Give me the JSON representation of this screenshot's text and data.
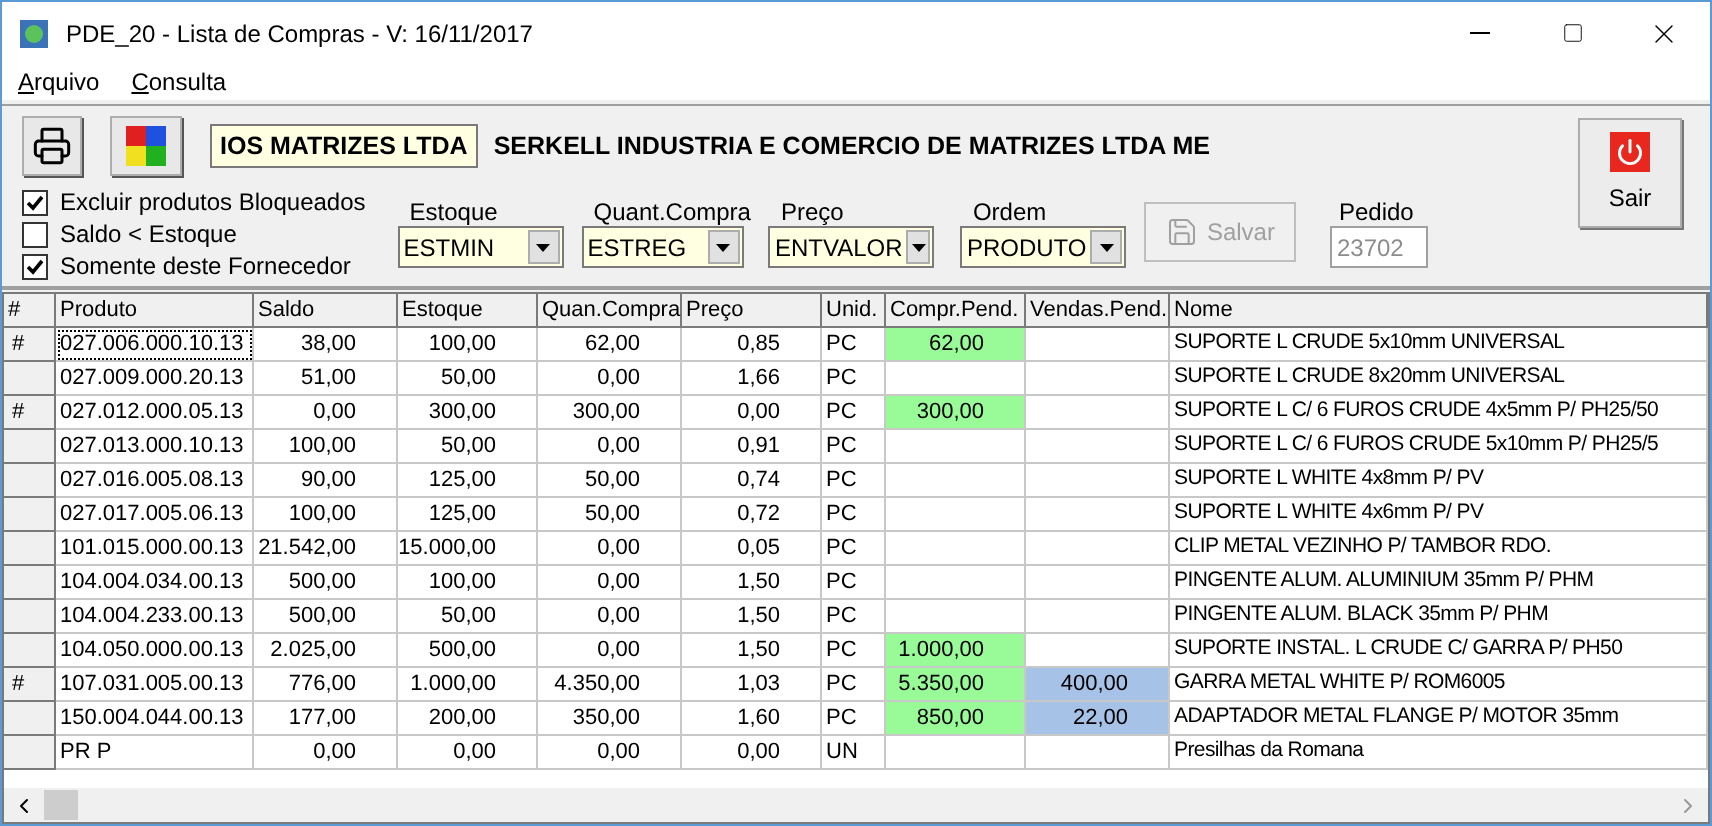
{
  "window": {
    "title": "PDE_20 - Lista de Compras - V: 16/11/2017"
  },
  "menu": [
    "Arquivo",
    "Consulta"
  ],
  "supplier": {
    "code": "IOS MATRIZES LTDA",
    "name": "SERKELL INDUSTRIA E COMERCIO DE MATRIZES LTDA ME"
  },
  "options": [
    {
      "label": "Excluir produtos Bloqueados",
      "checked": true
    },
    {
      "label": "Saldo < Estoque",
      "checked": false
    },
    {
      "label": "Somente deste Fornecedor",
      "checked": true
    }
  ],
  "dropdowns": [
    {
      "label": "Estoque",
      "value": "ESTMIN"
    },
    {
      "label": "Quant.Compra",
      "value": "ESTREG"
    },
    {
      "label": "Preço",
      "value": "ENTVALOR"
    },
    {
      "label": "Ordem",
      "value": "PRODUTO"
    }
  ],
  "save_button": {
    "label": "Salvar",
    "disabled": true
  },
  "order": {
    "label": "Pedido",
    "value": "23702",
    "disabled": true
  },
  "exit_button": {
    "label": "Sair"
  },
  "table": {
    "columns": [
      "#",
      "Produto",
      "Saldo",
      "Estoque",
      "Quan.Compra",
      "Preço",
      "Unid.",
      "Compr.Pend.",
      "Vendas.Pend.",
      "Nome"
    ],
    "rows": [
      {
        "marker": "#",
        "focused": true,
        "produto": "027.006.000.10.13",
        "saldo": "38,00",
        "estoque": "100,00",
        "quan_compra": "62,00",
        "preco": "0,85",
        "unid": "PC",
        "compr_pend": {
          "text": "62,00",
          "color": "#98fb98"
        },
        "nome": "SUPORTE L CRUDE 5x10mm UNIVERSAL"
      },
      {
        "focused": false,
        "produto": "027.009.000.20.13",
        "saldo": "51,00",
        "estoque": "50,00",
        "quan_compra": "0,00",
        "preco": "1,66",
        "unid": "PC",
        "nome": "SUPORTE L CRUDE 8x20mm UNIVERSAL"
      },
      {
        "marker": "#",
        "focused": false,
        "produto": "027.012.000.05.13",
        "saldo": "0,00",
        "estoque": "300,00",
        "quan_compra": "300,00",
        "preco": "0,00",
        "unid": "PC",
        "compr_pend": {
          "text": "300,00",
          "color": "#98fb98"
        },
        "nome": "SUPORTE L C/ 6 FUROS CRUDE 4x5mm P/ PH25/50"
      },
      {
        "focused": false,
        "produto": "027.013.000.10.13",
        "saldo": "100,00",
        "estoque": "50,00",
        "quan_compra": "0,00",
        "preco": "0,91",
        "unid": "PC",
        "nome": "SUPORTE L C/ 6 FUROS CRUDE 5x10mm P/ PH25/5"
      },
      {
        "focused": false,
        "produto": "027.016.005.08.13",
        "saldo": "90,00",
        "estoque": "125,00",
        "quan_compra": "50,00",
        "preco": "0,74",
        "unid": "PC",
        "nome": "SUPORTE L WHITE 4x8mm P/ PV"
      },
      {
        "focused": false,
        "produto": "027.017.005.06.13",
        "saldo": "100,00",
        "estoque": "125,00",
        "quan_compra": "50,00",
        "preco": "0,72",
        "unid": "PC",
        "nome": "SUPORTE L WHITE 4x6mm P/ PV"
      },
      {
        "focused": false,
        "produto": "101.015.000.00.13",
        "saldo": "21.542,00",
        "estoque": "15.000,00",
        "quan_compra": "0,00",
        "preco": "0,05",
        "unid": "PC",
        "nome": "CLIP METAL VEZINHO P/ TAMBOR RDO."
      },
      {
        "focused": false,
        "produto": "104.004.034.00.13",
        "saldo": "500,00",
        "estoque": "100,00",
        "quan_compra": "0,00",
        "preco": "1,50",
        "unid": "PC",
        "nome": "PINGENTE ALUM. ALUMINIUM 35mm P/ PHM"
      },
      {
        "focused": false,
        "produto": "104.004.233.00.13",
        "saldo": "500,00",
        "estoque": "50,00",
        "quan_compra": "0,00",
        "preco": "1,50",
        "unid": "PC",
        "nome": "PINGENTE ALUM. BLACK 35mm P/ PHM"
      },
      {
        "focused": false,
        "produto": "104.050.000.00.13",
        "saldo": "2.025,00",
        "estoque": "500,00",
        "quan_compra": "0,00",
        "preco": "1,50",
        "unid": "PC",
        "compr_pend": {
          "text": "1.000,00",
          "color": "#98fb98"
        },
        "nome": "SUPORTE INSTAL. L CRUDE C/ GARRA P/ PH50"
      },
      {
        "marker": "#",
        "focused": false,
        "produto": "107.031.005.00.13",
        "saldo": "776,00",
        "estoque": "1.000,00",
        "quan_compra": "4.350,00",
        "preco": "1,03",
        "unid": "PC",
        "compr_pend": {
          "text": "5.350,00",
          "color": "#98fb98"
        },
        "vendas_pend": {
          "text": "400,00",
          "color": "#a6c2e6"
        },
        "nome": "GARRA METAL WHITE P/ ROM6005"
      },
      {
        "focused": false,
        "produto": "150.004.044.00.13",
        "saldo": "177,00",
        "estoque": "200,00",
        "quan_compra": "350,00",
        "preco": "1,60",
        "unid": "PC",
        "compr_pend": {
          "text": "850,00",
          "color": "#98fb98"
        },
        "vendas_pend": {
          "text": "22,00",
          "color": "#a6c2e6"
        },
        "nome": "ADAPTADOR METAL FLANGE P/ MOTOR 35mm"
      },
      {
        "focused": false,
        "produto": "PR P",
        "saldo": "0,00",
        "estoque": "0,00",
        "quan_compra": "0,00",
        "preco": "0,00",
        "unid": "UN",
        "nome": "Presilhas da Romana"
      }
    ]
  }
}
